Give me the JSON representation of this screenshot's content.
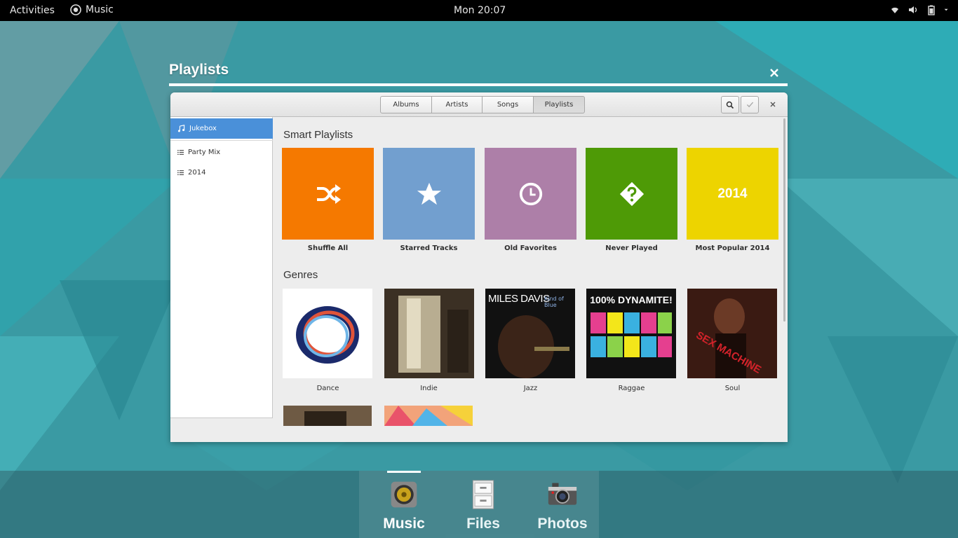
{
  "topbar": {
    "activities": "Activities",
    "app_name": "Music",
    "clock": "Mon 20:07"
  },
  "overview": {
    "title": "Playlists"
  },
  "window": {
    "tabs": [
      {
        "label": "Albums",
        "active": false
      },
      {
        "label": "Artists",
        "active": false
      },
      {
        "label": "Songs",
        "active": false
      },
      {
        "label": "Playlists",
        "active": true
      }
    ],
    "sidebar": {
      "items": [
        {
          "label": "Jukebox",
          "icon": "music-note-icon",
          "selected": true
        },
        {
          "label": "Party Mix",
          "icon": "list-icon",
          "selected": false
        },
        {
          "label": "2014",
          "icon": "list-icon",
          "selected": false
        }
      ]
    },
    "smart_playlists": {
      "title": "Smart Playlists",
      "items": [
        {
          "label": "Shuffle All",
          "color": "#f57900",
          "icon": "shuffle-icon"
        },
        {
          "label": "Starred Tracks",
          "color": "#729fcf",
          "icon": "star-icon"
        },
        {
          "label": "Old Favorites",
          "color": "#ad7fa8",
          "icon": "clock-icon"
        },
        {
          "label": "Never Played",
          "color": "#4e9a06",
          "icon": "question-icon"
        },
        {
          "label": "Most Popular 2014",
          "color": "#edd400",
          "tile_text": "2014"
        }
      ]
    },
    "genres": {
      "title": "Genres",
      "items": [
        {
          "label": "Dance"
        },
        {
          "label": "Indie"
        },
        {
          "label": "Jazz",
          "cover_artist": "MILES DAVIS",
          "cover_title": "Kind of Blue"
        },
        {
          "label": "Raggae",
          "cover_title": "100% DYNAMITE!"
        },
        {
          "label": "Soul",
          "cover_title": "SEX MACHINE"
        }
      ]
    }
  },
  "dock": {
    "apps": [
      {
        "label": "Music",
        "icon": "speaker-icon",
        "active": true
      },
      {
        "label": "Files",
        "icon": "file-cabinet-icon",
        "active": false
      },
      {
        "label": "Photos",
        "icon": "camera-icon",
        "active": false
      }
    ]
  }
}
